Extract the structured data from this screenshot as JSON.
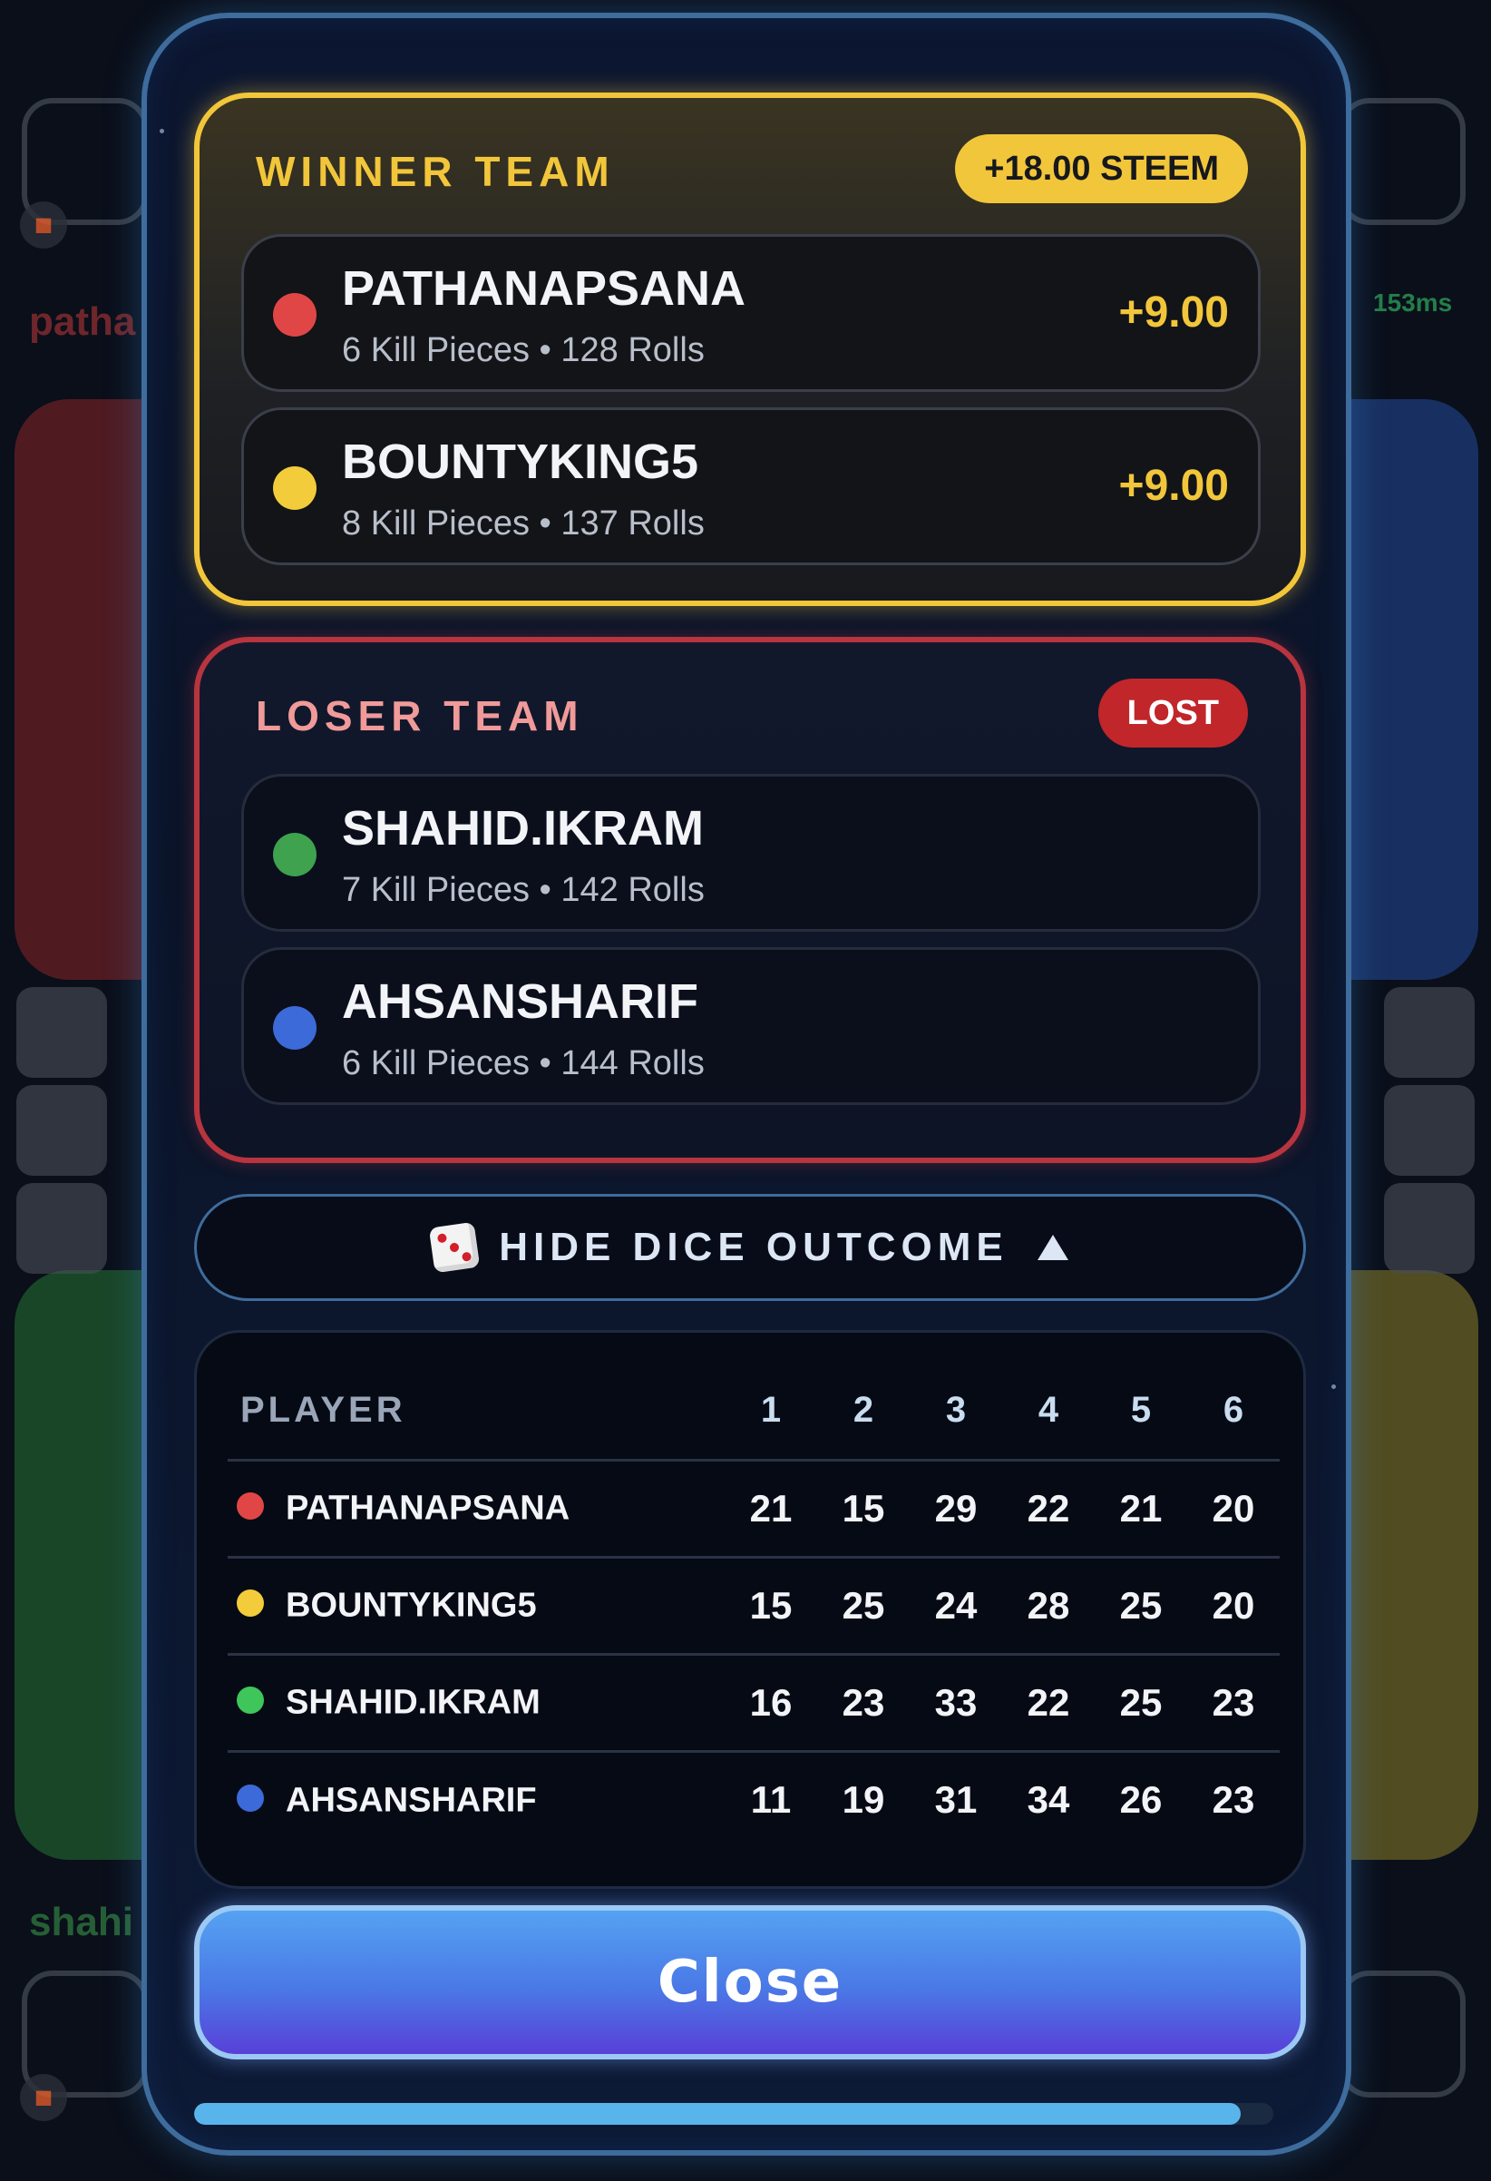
{
  "background": {
    "player_top_left": "patha",
    "player_bottom_left": "shahi",
    "ping": "153ms"
  },
  "winner": {
    "title": "WINNER TEAM",
    "badge": "+18.00 STEEM",
    "players": [
      {
        "name": "PATHANAPSANA",
        "stats": "6 Kill Pieces • 128 Rolls",
        "score": "+9.00",
        "color": "#e04646"
      },
      {
        "name": "BOUNTYKING5",
        "stats": "8 Kill Pieces • 137 Rolls",
        "score": "+9.00",
        "color": "#f2cc3a"
      }
    ]
  },
  "loser": {
    "title": "LOSER TEAM",
    "badge": "LOST",
    "players": [
      {
        "name": "SHAHID.IKRAM",
        "stats": "7 Kill Pieces • 142 Rolls",
        "color": "#3ea24e"
      },
      {
        "name": "AHSANSHARIF",
        "stats": "6 Kill Pieces • 144 Rolls",
        "color": "#3c6ad8"
      }
    ]
  },
  "dice_toggle": {
    "label": "HIDE DICE OUTCOME",
    "icon": "dice-icon",
    "arrow_icon": "triangle-up-icon"
  },
  "dice_table": {
    "headers": [
      "PLAYER",
      "1",
      "2",
      "3",
      "4",
      "5",
      "6"
    ],
    "rows": [
      {
        "name": "PATHANAPSANA",
        "color": "#e04646",
        "values": [
          "21",
          "15",
          "29",
          "22",
          "21",
          "20"
        ]
      },
      {
        "name": "BOUNTYKING5",
        "color": "#f2cc3a",
        "values": [
          "15",
          "25",
          "24",
          "28",
          "25",
          "20"
        ]
      },
      {
        "name": "SHAHID.IKRAM",
        "color": "#3ec65a",
        "values": [
          "16",
          "23",
          "33",
          "22",
          "25",
          "23"
        ]
      },
      {
        "name": "AHSANSHARIF",
        "color": "#3c6ad8",
        "values": [
          "11",
          "19",
          "31",
          "34",
          "26",
          "23"
        ]
      }
    ]
  },
  "close_button": {
    "label": "Close"
  },
  "progress": {
    "value": 0.97
  }
}
